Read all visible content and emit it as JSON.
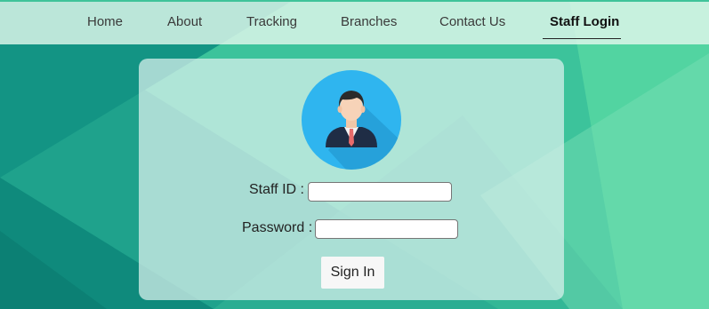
{
  "colors": {
    "accent": "#3fc39a",
    "background_dark": "#0e8f80",
    "background_light": "#4ecf9b",
    "avatar_circle": "#2fb5ef",
    "card": "#d8f0ec"
  },
  "nav": {
    "items": [
      {
        "label": "Home"
      },
      {
        "label": "About"
      },
      {
        "label": "Tracking"
      },
      {
        "label": "Branches"
      },
      {
        "label": "Contact Us"
      },
      {
        "label": "Staff Login",
        "active": true
      }
    ]
  },
  "login": {
    "avatar_icon": "staff-avatar-icon",
    "staff_id_label": "Staff ID :",
    "staff_id_value": "",
    "password_label": "Password :",
    "password_value": "",
    "signin_label": "Sign In"
  }
}
